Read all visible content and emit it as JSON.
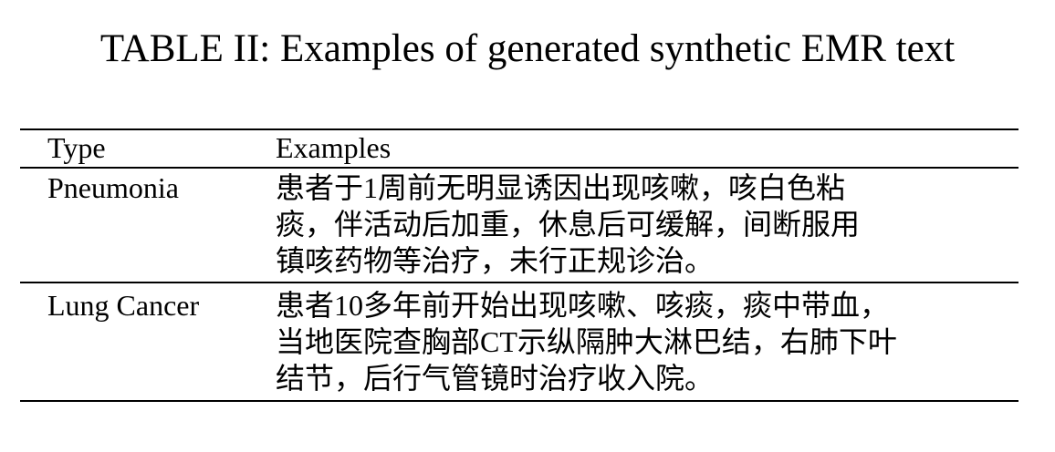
{
  "caption": "TABLE II: Examples of generated synthetic EMR text",
  "table": {
    "headers": [
      "Type",
      "Examples"
    ],
    "rows": [
      {
        "type": "Pneumonia",
        "example_lines": [
          "患者于1周前无明显诱因出现咳嗽，咳白色粘",
          "痰，伴活动后加重，休息后可缓解，间断服用",
          "镇咳药物等治疗，未行正规诊治。"
        ]
      },
      {
        "type": "Lung Cancer",
        "example_lines": [
          "患者10多年前开始出现咳嗽、咳痰，痰中带血，",
          "当地医院查胸部CT示纵隔肿大淋巴结，右肺下叶",
          "结节，后行气管镜时治疗收入院。"
        ]
      }
    ]
  }
}
